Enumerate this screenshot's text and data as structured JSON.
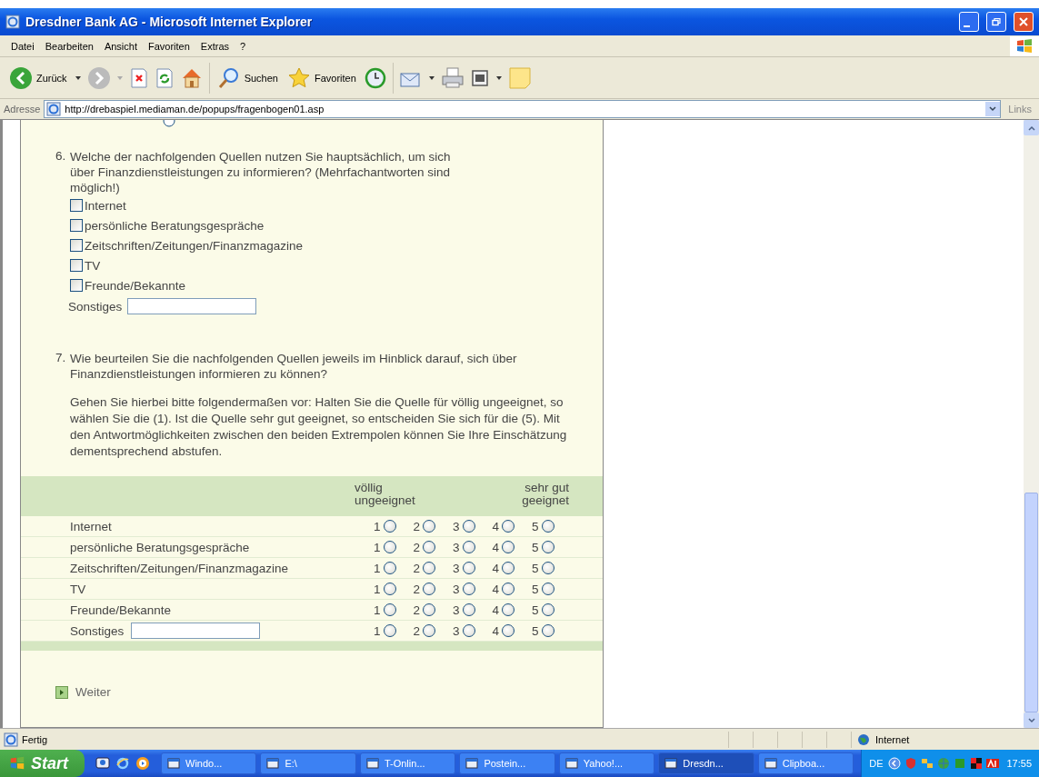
{
  "window": {
    "title": "Dresdner Bank AG - Microsoft Internet Explorer"
  },
  "menu": [
    "Datei",
    "Bearbeiten",
    "Ansicht",
    "Favoriten",
    "Extras",
    "?"
  ],
  "toolbar": {
    "back": "Zurück",
    "search": "Suchen",
    "favorites": "Favoriten"
  },
  "address": {
    "label": "Adresse",
    "url": "http://drebaspiel.mediaman.de/popups/fragenbogen01.asp",
    "links": "Links"
  },
  "q5_tail_radio": {
    "selected": false
  },
  "q6": {
    "number": "6.",
    "text": "Welche der nachfolgenden Quellen nutzen Sie hauptsächlich, um sich über Finanzdienstleistungen zu informieren? (Mehrfachantworten sind möglich!)",
    "options": [
      {
        "label": "Internet",
        "checked": false
      },
      {
        "label": "persönliche Beratungsgespräche",
        "checked": false
      },
      {
        "label": "Zeitschriften/Zeitungen/Finanzmagazine",
        "checked": false
      },
      {
        "label": "TV",
        "checked": false
      },
      {
        "label": "Freunde/Bekannte",
        "checked": false
      }
    ],
    "other_label": "Sonstiges"
  },
  "q7": {
    "number": "7.",
    "text": "Wie beurteilen Sie die nachfolgenden Quellen jeweils im Hinblick darauf, sich über Finanzdienstleistungen informieren zu können?",
    "instructions": "Gehen Sie hierbei bitte folgendermaßen vor: Halten Sie die Quelle für völlig ungeeignet, so wählen Sie die (1). Ist die Quelle sehr gut geeignet, so entscheiden Sie sich für die (5). Mit den Antwortmöglichkeiten zwischen den beiden Extrempolen können Sie Ihre Einschätzung dementsprechend abstufen.",
    "scale_low": "völlig ungeeignet",
    "scale_high": "sehr gut geeignet",
    "rows": [
      {
        "label": "Internet",
        "kind": "plain",
        "ratings": [
          {
            "label": "1",
            "selected": false
          },
          {
            "label": "2",
            "selected": false
          },
          {
            "label": "3",
            "selected": false
          },
          {
            "label": "4",
            "selected": false
          },
          {
            "label": "5",
            "selected": false
          }
        ]
      },
      {
        "label": "persönliche Beratungsgespräche",
        "kind": "plain",
        "ratings": [
          {
            "label": "1",
            "selected": false
          },
          {
            "label": "2",
            "selected": false
          },
          {
            "label": "3",
            "selected": false
          },
          {
            "label": "4",
            "selected": false
          },
          {
            "label": "5",
            "selected": false
          }
        ]
      },
      {
        "label": "Zeitschriften/Zeitungen/Finanzmagazine",
        "kind": "plain",
        "ratings": [
          {
            "label": "1",
            "selected": false
          },
          {
            "label": "2",
            "selected": false
          },
          {
            "label": "3",
            "selected": false
          },
          {
            "label": "4",
            "selected": false
          },
          {
            "label": "5",
            "selected": false
          }
        ]
      },
      {
        "label": "TV",
        "kind": "plain",
        "ratings": [
          {
            "label": "1",
            "selected": false
          },
          {
            "label": "2",
            "selected": false
          },
          {
            "label": "3",
            "selected": false
          },
          {
            "label": "4",
            "selected": false
          },
          {
            "label": "5",
            "selected": false
          }
        ]
      },
      {
        "label": "Freunde/Bekannte",
        "kind": "plain",
        "ratings": [
          {
            "label": "1",
            "selected": false
          },
          {
            "label": "2",
            "selected": false
          },
          {
            "label": "3",
            "selected": false
          },
          {
            "label": "4",
            "selected": false
          },
          {
            "label": "5",
            "selected": false
          }
        ]
      },
      {
        "label": "Sonstiges",
        "kind": "input",
        "ratings": [
          {
            "label": "1",
            "selected": false
          },
          {
            "label": "2",
            "selected": false
          },
          {
            "label": "3",
            "selected": false
          },
          {
            "label": "4",
            "selected": false
          },
          {
            "label": "5",
            "selected": false
          }
        ]
      }
    ]
  },
  "next": "Weiter",
  "status_bar": {
    "text": "Fertig",
    "zone": "Internet"
  },
  "taskbar": {
    "start": "Start",
    "tasks": [
      {
        "label": "Windo...",
        "selected": false
      },
      {
        "label": "E:\\",
        "selected": false
      },
      {
        "label": "T-Onlin...",
        "selected": false
      },
      {
        "label": "Postein...",
        "selected": false
      },
      {
        "label": "Yahoo!...",
        "selected": false
      },
      {
        "label": "Dresdn...",
        "selected": true
      },
      {
        "label": "Clipboa...",
        "selected": false
      }
    ],
    "language": "DE",
    "clock": "17:55"
  }
}
